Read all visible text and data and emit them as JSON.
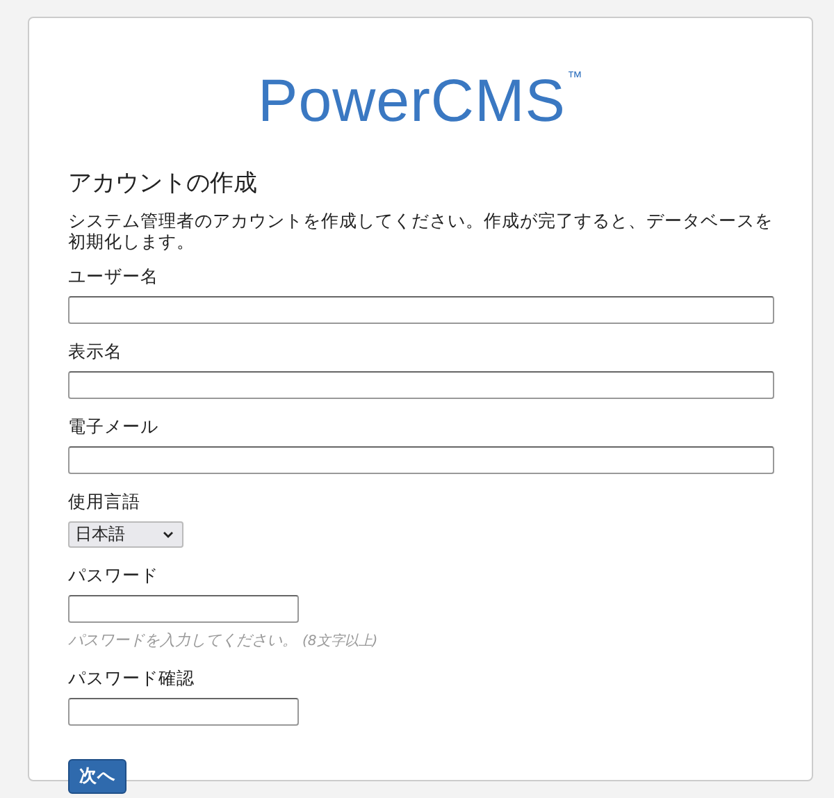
{
  "logo": {
    "name": "PowerCMS",
    "mark": "™"
  },
  "heading": "アカウントの作成",
  "intro": "システム管理者のアカウントを作成してください。作成が完了すると、データベースを初期化します。",
  "fields": [
    {
      "kind": "text",
      "label": "ユーザー名"
    },
    {
      "kind": "text",
      "label": "表示名"
    },
    {
      "kind": "text",
      "label": "電子メール"
    },
    {
      "kind": "select",
      "label": "使用言語",
      "value": "日本語"
    },
    {
      "kind": "password",
      "label": "パスワード",
      "hint": "パスワードを入力してください。",
      "hint_note": "(8文字以上)"
    },
    {
      "kind": "password",
      "label": "パスワード確認"
    }
  ],
  "button": "次へ"
}
